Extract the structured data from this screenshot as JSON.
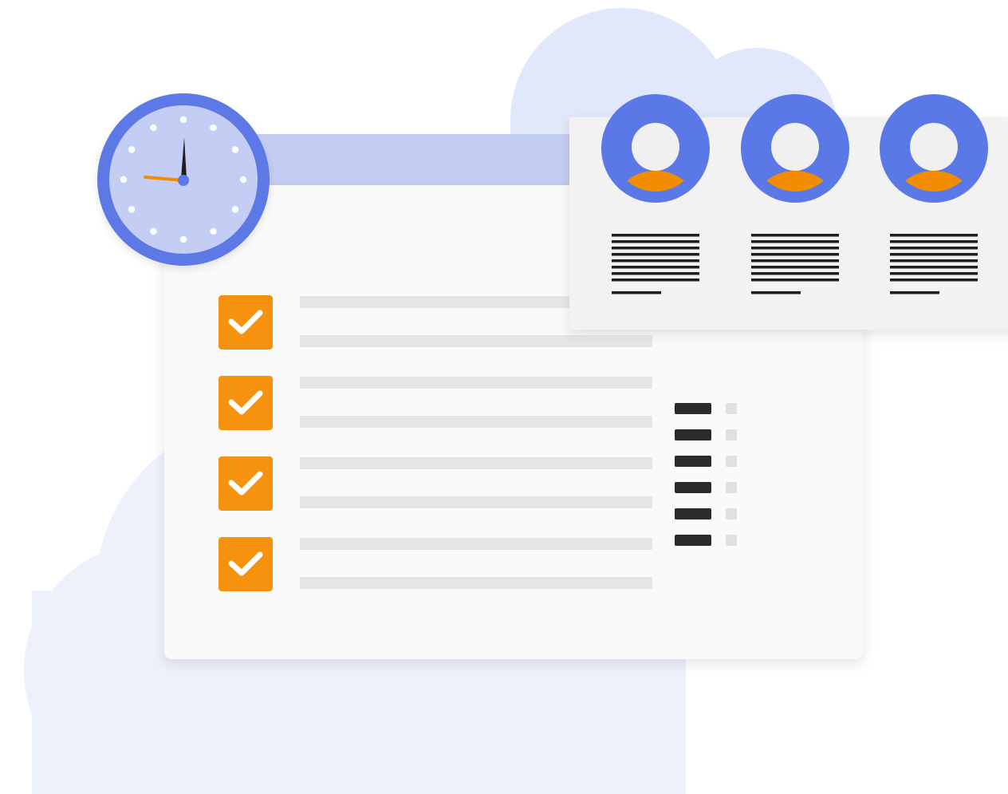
{
  "colors": {
    "background": "#ffffff",
    "cloud_back": "#e2e8fb",
    "cloud_front": "#edf1fc",
    "clock_ring": "#5b79e6",
    "clock_face": "#c4cdf3",
    "clock_dots": "#ffffff",
    "clock_hour_hand": "#1e1e1e",
    "clock_minute_hand": "#f28c00",
    "clock_center": "#5b79e6",
    "header_bar": "#c4cdf3",
    "main_card": "#fafafa",
    "checkbox": "#f7920f",
    "checkmark": "#ffffff",
    "placeholder_line": "#e6e6e6",
    "legend_dark": "#2a2a2a",
    "legend_light": "#e0e0e0",
    "team_card": "#f2f2f2",
    "avatar_ring": "#5b79e6",
    "avatar_head": "#f0f0f0",
    "avatar_body": "#f28c00",
    "text_line": "#1f1f1f"
  },
  "icons": {
    "clock": "clock-icon",
    "checkbox": "checkbox-checked-icon",
    "avatar": "user-avatar-icon",
    "text_placeholder": "text-lines-icon",
    "cloud": "cloud-shape"
  },
  "checklist": {
    "items": [
      {
        "checked": true
      },
      {
        "checked": true
      },
      {
        "checked": true
      },
      {
        "checked": true
      }
    ]
  },
  "legend": {
    "rows": 6
  },
  "team": {
    "members": 3
  }
}
